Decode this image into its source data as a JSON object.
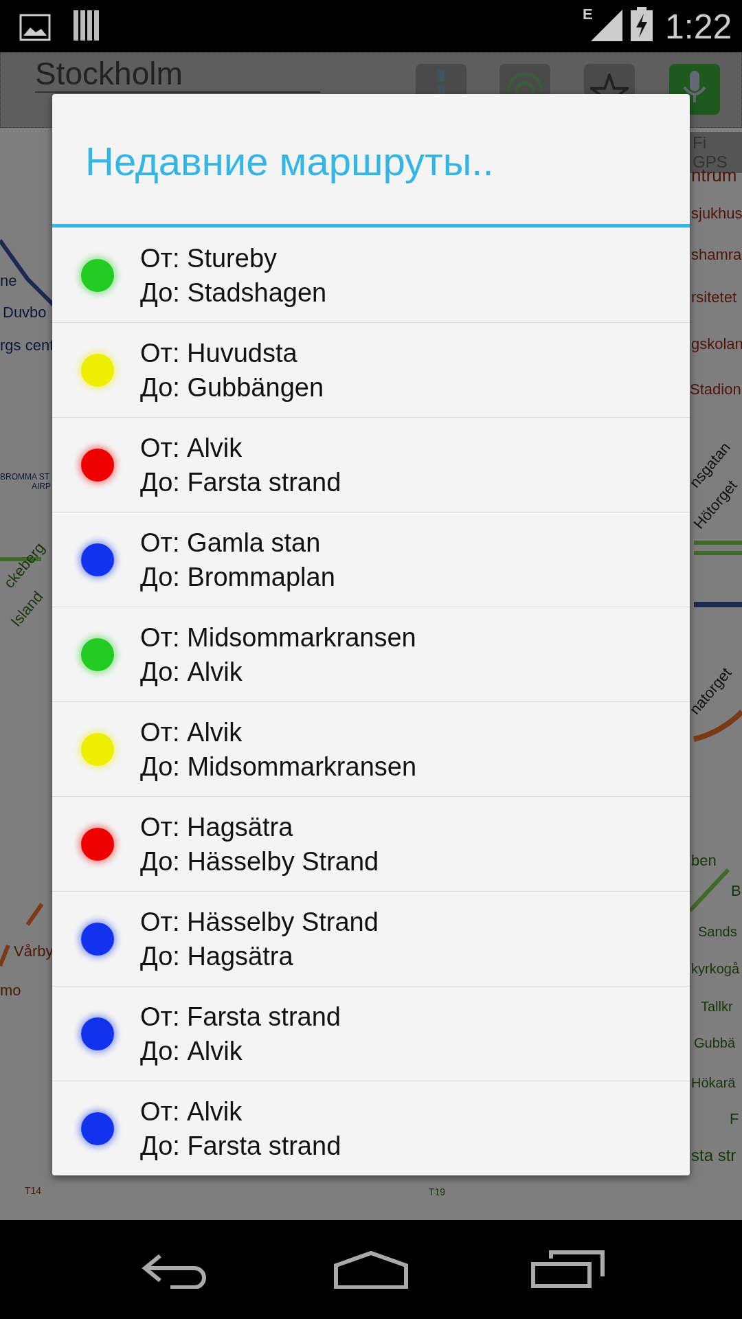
{
  "status_bar": {
    "network": "E",
    "time": "1:22"
  },
  "map": {
    "search_text": "Stockholm",
    "gps_text": "Fi GPS",
    "labels": [
      "ne",
      "Duvbo",
      "rgs cent",
      "BROMMA ST",
      "AIRP",
      "ckeberg",
      "Island",
      "Vårby",
      "mo",
      "ntrum",
      "sjukhus",
      "shamra",
      "rsitetet",
      "gskolan",
      "Stadion",
      "nsgatan",
      "Hötorget",
      "natorget",
      "ben",
      "B",
      "Sands",
      "kyrkogå",
      "Tallkr",
      "Gubbä",
      "Hökarä",
      "F",
      "sta str",
      "T14",
      "T19"
    ]
  },
  "dialog": {
    "title": "Недавние маршруты..",
    "routes": [
      {
        "from": "От: Stureby",
        "to": "До: Stadshagen",
        "color": "#22cc22"
      },
      {
        "from": "От: Huvudsta",
        "to": "До: Gubbängen",
        "color": "#eeee00"
      },
      {
        "from": "От: Alvik",
        "to": "До: Farsta strand",
        "color": "#ee0000"
      },
      {
        "from": "От: Gamla stan",
        "to": "До: Brommaplan",
        "color": "#1133ee"
      },
      {
        "from": "От: Midsommarkransen",
        "to": "До: Alvik",
        "color": "#22cc22"
      },
      {
        "from": "От: Alvik",
        "to": "До: Midsommarkransen",
        "color": "#eeee00"
      },
      {
        "from": "От: Hagsätra",
        "to": "До: Hässelby Strand",
        "color": "#ee0000"
      },
      {
        "from": "От: Hässelby Strand",
        "to": "До: Hagsätra",
        "color": "#1133ee"
      },
      {
        "from": "От: Farsta strand",
        "to": "До: Alvik",
        "color": "#1133ee"
      },
      {
        "from": "От: Alvik",
        "to": "До: Farsta strand",
        "color": "#1133ee"
      }
    ]
  }
}
